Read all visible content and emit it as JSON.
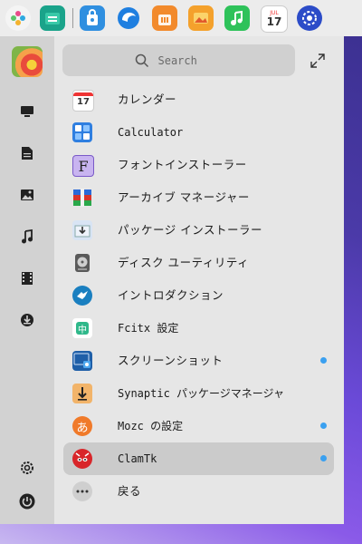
{
  "dock": {
    "apps": [
      {
        "icon": "launcher-icon"
      },
      {
        "icon": "file-manager-icon"
      },
      {
        "icon": "app-store-icon"
      },
      {
        "icon": "browser-icon"
      },
      {
        "icon": "shopping-bag-icon"
      },
      {
        "icon": "image-viewer-icon"
      },
      {
        "icon": "music-icon"
      },
      {
        "icon": "calendar-icon",
        "text_month": "JUL",
        "text_day": "17"
      },
      {
        "icon": "settings-icon"
      }
    ]
  },
  "sidebar": {
    "items": [
      {
        "icon": "desktop-icon"
      },
      {
        "icon": "document-icon"
      },
      {
        "icon": "picture-icon"
      },
      {
        "icon": "music-note-icon"
      },
      {
        "icon": "video-icon"
      },
      {
        "icon": "download-icon"
      },
      {
        "icon": "settings-icon"
      },
      {
        "icon": "power-icon"
      }
    ]
  },
  "search": {
    "placeholder": "Search"
  },
  "apps": [
    {
      "label": "カレンダー",
      "icon": "calendar-icon",
      "day": "17",
      "new": false
    },
    {
      "label": "Calculator",
      "icon": "calculator-icon",
      "new": false
    },
    {
      "label": "フォントインストーラー",
      "icon": "font-installer-icon",
      "letter": "F",
      "new": false
    },
    {
      "label": "アーカイブ マネージャー",
      "icon": "archive-manager-icon",
      "new": false
    },
    {
      "label": "パッケージ インストーラー",
      "icon": "package-installer-icon",
      "new": false
    },
    {
      "label": "ディスク ユーティリティ",
      "icon": "disk-utility-icon",
      "new": false
    },
    {
      "label": "イントロダクション",
      "icon": "introduction-icon",
      "new": false
    },
    {
      "label": "Fcitx 設定",
      "icon": "fcitx-icon",
      "letter": "中",
      "new": false
    },
    {
      "label": "スクリーンショット",
      "icon": "screenshot-icon",
      "new": true
    },
    {
      "label": "Synaptic パッケージマネージャ",
      "icon": "synaptic-icon",
      "new": false
    },
    {
      "label": "Mozc の設定",
      "icon": "mozc-icon",
      "letter": "あ",
      "new": true
    },
    {
      "label": "ClamTk",
      "icon": "clamtk-icon",
      "new": true,
      "selected": true
    },
    {
      "label": "戻る",
      "icon": "more-icon",
      "new": false
    }
  ],
  "colors": {
    "accent": "#3aa0f0",
    "panel": "#e6e6e6",
    "sidebar": "#d2d2d2"
  }
}
